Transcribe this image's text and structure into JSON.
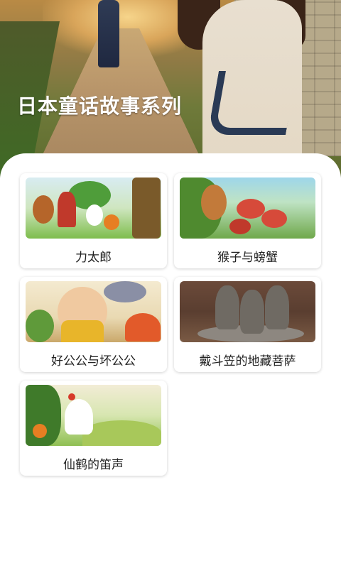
{
  "header": {
    "title": "日本童话故事系列"
  },
  "stories": [
    {
      "title": "力太郎",
      "art": "art1"
    },
    {
      "title": "猴子与螃蟹",
      "art": "art2"
    },
    {
      "title": "好公公与坏公公",
      "art": "art3"
    },
    {
      "title": "戴斗笠的地藏菩萨",
      "art": "art4"
    },
    {
      "title": "仙鹤的笛声",
      "art": "art5"
    }
  ]
}
